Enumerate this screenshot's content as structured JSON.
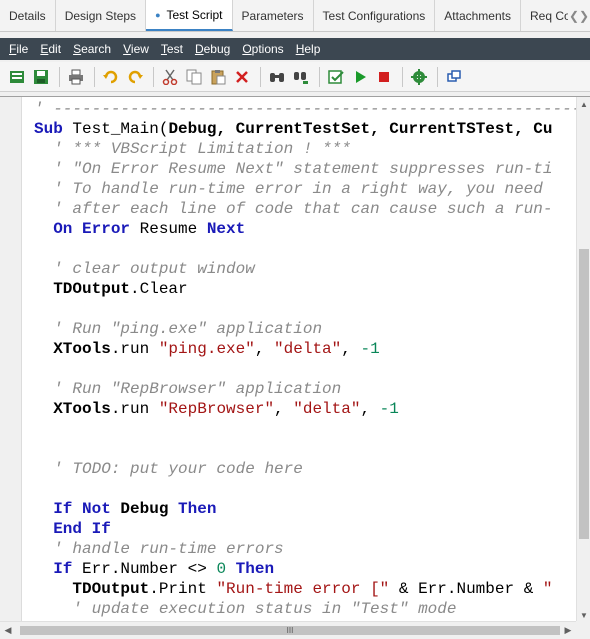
{
  "tabs": [
    {
      "label": "Details",
      "active": false
    },
    {
      "label": "Design Steps",
      "active": false
    },
    {
      "label": "Test Script",
      "active": true
    },
    {
      "label": "Parameters",
      "active": false
    },
    {
      "label": "Test Configurations",
      "active": false
    },
    {
      "label": "Attachments",
      "active": false
    },
    {
      "label": "Req Cove",
      "active": false
    }
  ],
  "menu": [
    {
      "key": "F",
      "rest": "ile"
    },
    {
      "key": "E",
      "rest": "dit"
    },
    {
      "key": "S",
      "rest": "earch"
    },
    {
      "key": "V",
      "rest": "iew"
    },
    {
      "key": "T",
      "rest": "est"
    },
    {
      "key": "D",
      "rest": "ebug"
    },
    {
      "key": "O",
      "rest": "ptions"
    },
    {
      "key": "H",
      "rest": "elp"
    }
  ],
  "toolbar": {
    "icons": [
      "new-script-icon",
      "save-icon",
      "print-icon",
      "undo-icon",
      "redo-icon",
      "cut-icon",
      "copy-icon",
      "paste-icon",
      "delete-icon",
      "find-icon",
      "replace-icon",
      "syntax-check-icon",
      "run-icon",
      "stop-icon",
      "settings-icon",
      "window-icon"
    ]
  },
  "colors": {
    "menubar_bg": "#3c4751",
    "keyword": "#1a1ab8",
    "comment": "#8a8a8a",
    "string": "#a31515",
    "number": "#098658",
    "tab_active_border": "#3b82c4"
  },
  "code_lines": [
    [
      [
        "cm",
        "' -------------------------------------------------------------"
      ]
    ],
    [
      [
        "kw",
        "Sub"
      ],
      [
        "id",
        " Test_Main("
      ],
      [
        "ob",
        "Debug, CurrentTestSet, CurrentTSTest, Cu"
      ]
    ],
    [
      [
        "cm",
        "  ' *** VBScript Limitation ! ***"
      ]
    ],
    [
      [
        "cm",
        "  ' \"On Error Resume Next\" statement suppresses run-ti"
      ]
    ],
    [
      [
        "cm",
        "  ' To handle run-time error in a right way, you need"
      ]
    ],
    [
      [
        "cm",
        "  ' after each line of code that can cause such a run-"
      ]
    ],
    [
      [
        "kw",
        "  On Error"
      ],
      [
        "id",
        " Resume "
      ],
      [
        "kw",
        "Next"
      ]
    ],
    [],
    [
      [
        "cm",
        "  ' clear output window"
      ]
    ],
    [
      [
        "ob",
        "  TDOutput"
      ],
      [
        "id",
        ".Clear"
      ]
    ],
    [],
    [
      [
        "cm",
        "  ' Run \"ping.exe\" application"
      ]
    ],
    [
      [
        "ob",
        "  XTools"
      ],
      [
        "id",
        ".run "
      ],
      [
        "st",
        "\"ping.exe\""
      ],
      [
        "id",
        ", "
      ],
      [
        "st",
        "\"delta\""
      ],
      [
        "id",
        ", "
      ],
      [
        "nm",
        "-1"
      ]
    ],
    [],
    [
      [
        "cm",
        "  ' Run \"RepBrowser\" application"
      ]
    ],
    [
      [
        "ob",
        "  XTools"
      ],
      [
        "id",
        ".run "
      ],
      [
        "st",
        "\"RepBrowser\""
      ],
      [
        "id",
        ", "
      ],
      [
        "st",
        "\"delta\""
      ],
      [
        "id",
        ", "
      ],
      [
        "nm",
        "-1"
      ]
    ],
    [],
    [],
    [
      [
        "cm",
        "  ' TODO: put your code here"
      ]
    ],
    [],
    [
      [
        "kw",
        "  If Not"
      ],
      [
        "ob",
        " Debug "
      ],
      [
        "kw",
        "Then"
      ]
    ],
    [
      [
        "kw",
        "  End If"
      ]
    ],
    [
      [
        "cm",
        "  ' handle run-time errors"
      ]
    ],
    [
      [
        "kw",
        "  If"
      ],
      [
        "id",
        " Err.Number <> "
      ],
      [
        "nm",
        "0"
      ],
      [
        "kw",
        " Then"
      ]
    ],
    [
      [
        "ob",
        "    TDOutput"
      ],
      [
        "id",
        ".Print "
      ],
      [
        "st",
        "\"Run-time error [\""
      ],
      [
        "id",
        " & Err.Number & "
      ],
      [
        "st",
        "\""
      ]
    ],
    [
      [
        "cm",
        "    ' update execution status in \"Test\" mode"
      ]
    ]
  ],
  "scroll": {
    "h_thumb_label": "III"
  }
}
